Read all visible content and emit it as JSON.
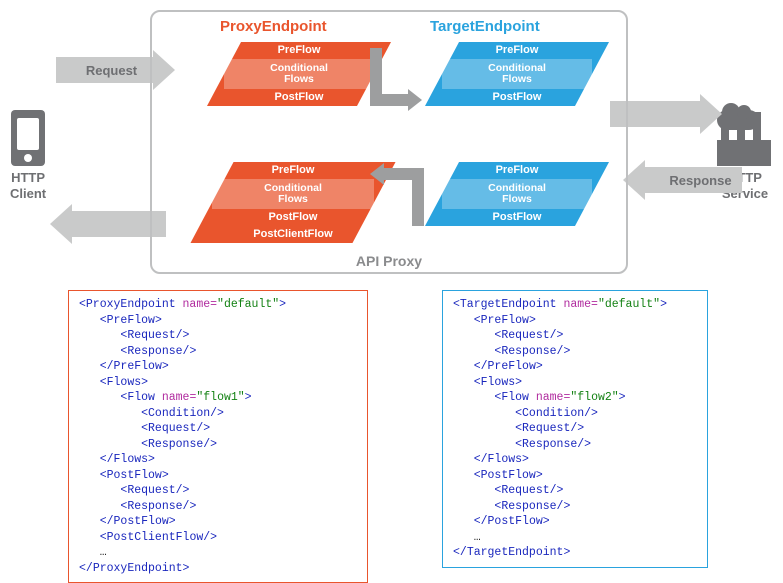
{
  "actors": {
    "client": "HTTP\nClient",
    "service": "HTTP\nService"
  },
  "arrows": {
    "request": "Request",
    "response": "Response"
  },
  "frame": {
    "title": "API Proxy",
    "proxyEndpoint": "ProxyEndpoint",
    "targetEndpoint": "TargetEndpoint"
  },
  "flows": {
    "preflow": "PreFlow",
    "conditional": "Conditional\nFlows",
    "postflow": "PostFlow",
    "postclient": "PostClientFlow"
  },
  "code": {
    "proxy": {
      "open": "ProxyEndpoint",
      "nameAttr": "name=",
      "nameVal": "\"default\"",
      "flowName": "\"flow1\"",
      "ellipsis": "…",
      "close": "ProxyEndpoint"
    },
    "target": {
      "open": "TargetEndpoint",
      "nameAttr": "name=",
      "nameVal": "\"default\"",
      "flowName": "\"flow2\"",
      "ellipsis": "…",
      "close": "TargetEndpoint"
    },
    "els": {
      "preflow": "PreFlow",
      "request": "Request",
      "response": "Response",
      "flows": "Flows",
      "flow": "Flow",
      "condition": "Condition",
      "postflow": "PostFlow",
      "postclient": "PostClientFlow"
    }
  }
}
